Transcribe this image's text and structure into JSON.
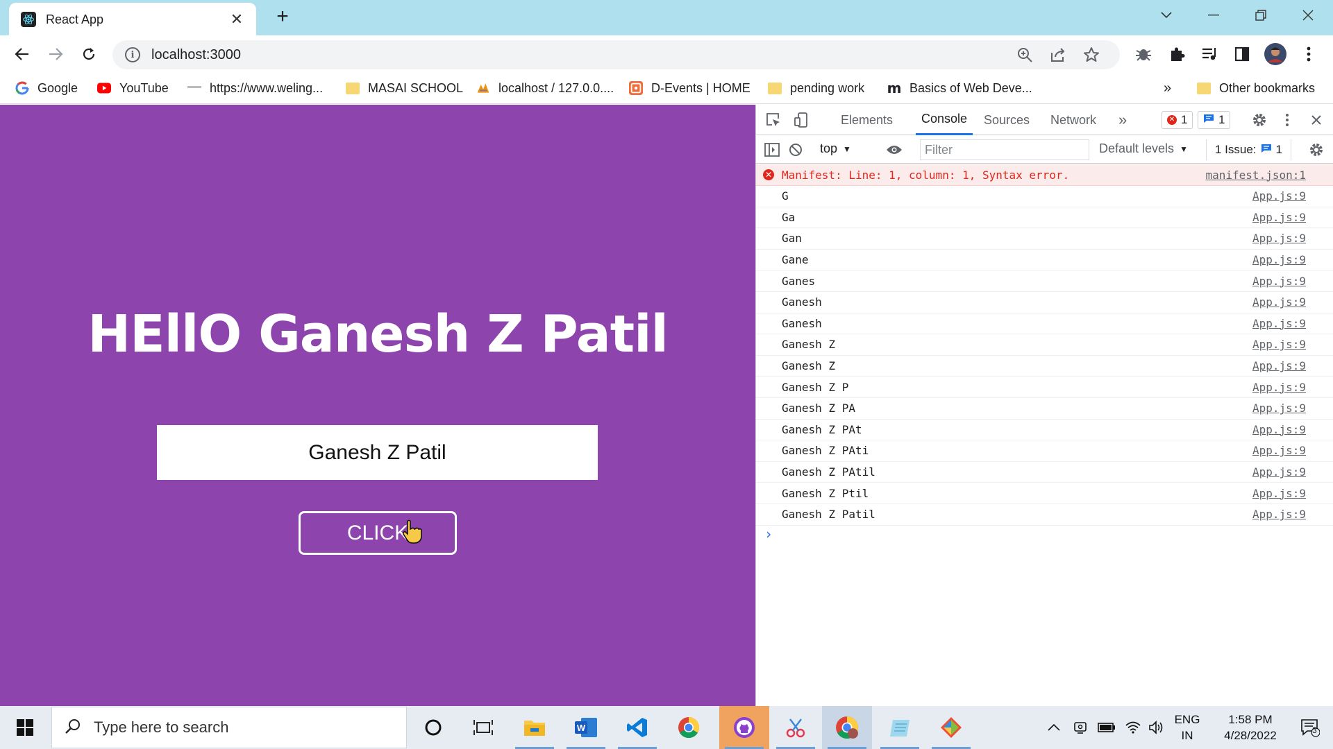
{
  "browser": {
    "tab_title": "React App",
    "url": "localhost:3000",
    "bookmarks": [
      {
        "label": "Google",
        "icon": "google-icon"
      },
      {
        "label": "YouTube",
        "icon": "youtube-icon"
      },
      {
        "label": "https://www.weling...",
        "icon": "site-icon"
      },
      {
        "label": "MASAI SCHOOL",
        "icon": "folder-icon"
      },
      {
        "label": "localhost / 127.0.0....",
        "icon": "phpmyadmin-icon"
      },
      {
        "label": "D-Events | HOME",
        "icon": "devents-icon"
      },
      {
        "label": "pending work",
        "icon": "folder-icon"
      },
      {
        "label": "Basics of Web Deve...",
        "icon": "m-icon"
      }
    ],
    "bookmarks_overflow": "»",
    "other_bookmarks": "Other bookmarks"
  },
  "app": {
    "background": "#8e44ad",
    "greeting": "HEllO Ganesh Z Patil",
    "input_value": "Ganesh Z Patil",
    "button_label": "CLICK"
  },
  "devtools": {
    "tabs": [
      "Elements",
      "Console",
      "Sources",
      "Network"
    ],
    "active_tab": "Console",
    "more": "»",
    "error_count": "1",
    "message_count": "1",
    "context": "top",
    "filter_placeholder": "Filter",
    "levels": "Default levels",
    "issues_label": "1 Issue:",
    "issues_count": "1",
    "error_message": {
      "text": "Manifest: Line: 1, column: 1, Syntax error.",
      "source": "manifest.json:1"
    },
    "logs": [
      {
        "text": "G",
        "source": "App.js:9"
      },
      {
        "text": "Ga",
        "source": "App.js:9"
      },
      {
        "text": "Gan",
        "source": "App.js:9"
      },
      {
        "text": "Gane",
        "source": "App.js:9"
      },
      {
        "text": "Ganes",
        "source": "App.js:9"
      },
      {
        "text": "Ganesh",
        "source": "App.js:9"
      },
      {
        "text": "Ganesh",
        "source": "App.js:9"
      },
      {
        "text": "Ganesh Z",
        "source": "App.js:9"
      },
      {
        "text": "Ganesh Z",
        "source": "App.js:9"
      },
      {
        "text": "Ganesh Z P",
        "source": "App.js:9"
      },
      {
        "text": "Ganesh Z PA",
        "source": "App.js:9"
      },
      {
        "text": "Ganesh Z PAt",
        "source": "App.js:9"
      },
      {
        "text": "Ganesh Z PAti",
        "source": "App.js:9"
      },
      {
        "text": "Ganesh Z PAtil",
        "source": "App.js:9"
      },
      {
        "text": "Ganesh Z Ptil",
        "source": "App.js:9"
      },
      {
        "text": "Ganesh Z Patil",
        "source": "App.js:9"
      }
    ],
    "prompt": "›"
  },
  "taskbar": {
    "search_placeholder": "Type here to search",
    "language": "ENG",
    "region": "IN",
    "time": "1:58 PM",
    "date": "4/28/2022",
    "notification_count": "3"
  }
}
